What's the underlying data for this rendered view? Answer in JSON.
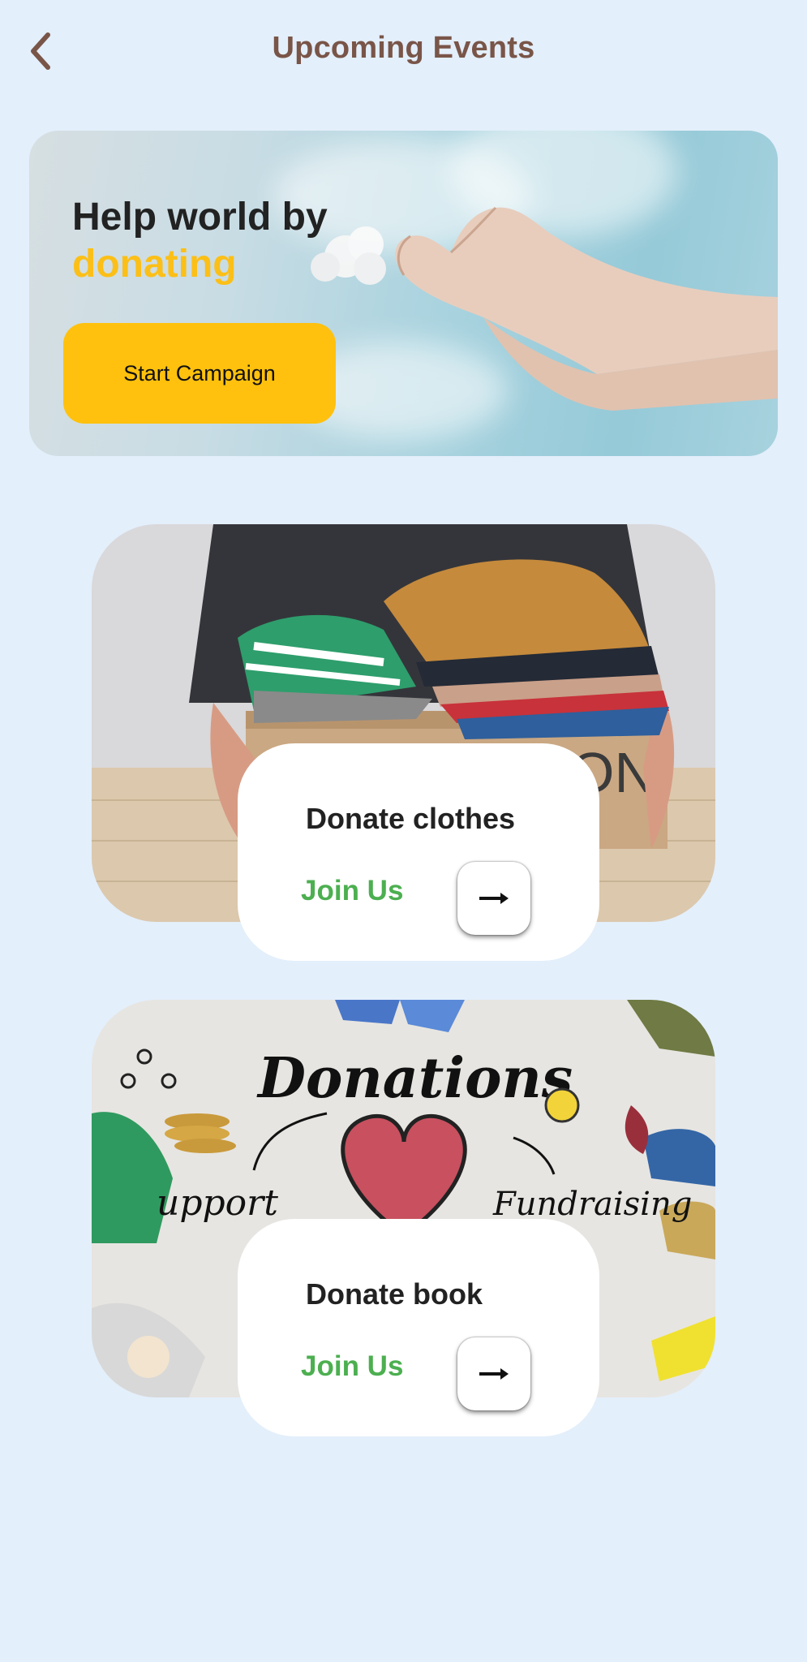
{
  "header": {
    "title": "Upcoming Events",
    "back_icon": "chevron-left-icon"
  },
  "hero": {
    "title_line1": "Help world by",
    "title_line2": "donating",
    "button_label": "Start Campaign",
    "accent_color": "#fbbf17",
    "button_color": "#ffc10d"
  },
  "events": [
    {
      "name": "Donate clothes",
      "join_label": "Join Us",
      "image": "box-of-clothes-photo",
      "image_text": "ON"
    },
    {
      "name": "Donate book",
      "join_label": "Join Us",
      "image": "donations-illustration-photo",
      "image_text": {
        "heading": "Donations",
        "left": "upport",
        "right": "Fundraising"
      }
    }
  ],
  "colors": {
    "background": "#e3effb",
    "title": "#795548",
    "join": "#4caf50"
  }
}
